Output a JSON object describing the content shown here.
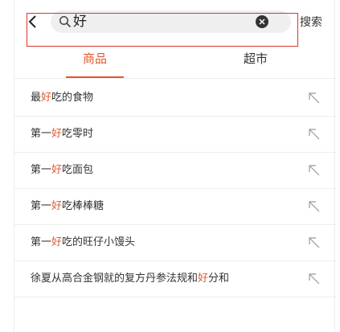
{
  "search": {
    "query": "好",
    "submit_label": "搜索"
  },
  "tabs": [
    {
      "label": "商品",
      "active": true
    },
    {
      "label": "超市",
      "active": false
    }
  ],
  "suggestions": [
    {
      "before": "最",
      "match": "好",
      "after": "吃的食物"
    },
    {
      "before": "第一",
      "match": "好",
      "after": "吃零时"
    },
    {
      "before": "第一",
      "match": "好",
      "after": "吃面包"
    },
    {
      "before": "第一",
      "match": "好",
      "after": "吃棒棒糖"
    },
    {
      "before": "第一",
      "match": "好",
      "after": "吃的旺仔小馒头"
    },
    {
      "before": "徐夏从高合金钢就的复方丹参法规和",
      "match": "好",
      "after": "分和"
    }
  ],
  "colors": {
    "accent": "#e4572e",
    "focus_outline": "#d9362f",
    "search_bg": "#efefef"
  },
  "icons": {
    "back": "chevron-left-icon",
    "search": "magnifier-icon",
    "clear": "clear-circle-icon",
    "fill": "arrow-up-left-icon"
  }
}
